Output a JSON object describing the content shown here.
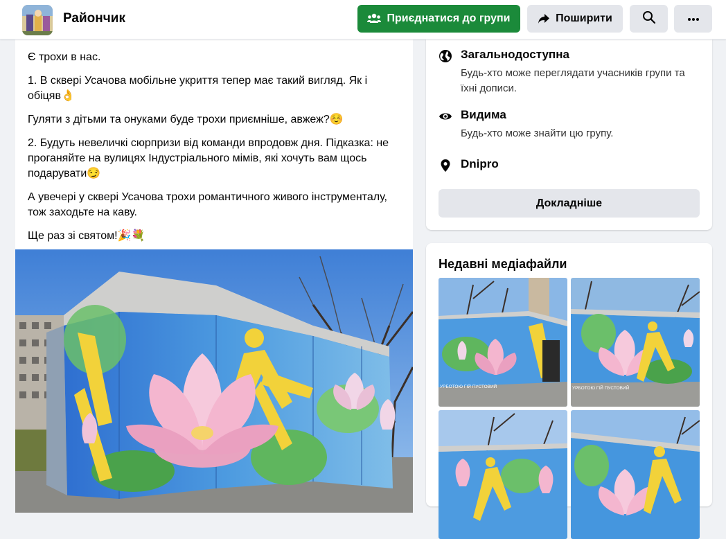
{
  "header": {
    "group_name": "Райончик",
    "join_label": "Приєднатися до групи",
    "share_label": "Поширити",
    "search_icon": "search-icon",
    "more_icon": "more-icon"
  },
  "post": {
    "paragraphs": [
      "Є трохи в нас.",
      "1. В сквері Усачова мобільне укриття тепер має такий вигляд. Як і обіцяв👌",
      "Гуляти з дітьми та онуками буде трохи приємніше, авжеж?☺️",
      "2. Будуть невеличкі сюрпризи від команди впродовж дня. Підказка: не проганяйте на вулицях Індустріального мімів, які хочуть вам щось подарувати😏",
      "А увечері у сквері Усачова трохи романтичного живого інструменталу, тож заходьте на каву.",
      "Ще раз зі святом!🎉💐"
    ]
  },
  "about": {
    "privacy_title": "Загальнодоступна",
    "privacy_desc": "Будь-хто може переглядати учасників групи та їхні дописи.",
    "visibility_title": "Видима",
    "visibility_desc": "Будь-хто може знайти цю групу.",
    "location": "Dnipro",
    "details_label": "Докладніше"
  },
  "media": {
    "title": "Недавні медіафайли",
    "thumb_captions": [
      "УРБОТОЮ ГІЙ ПУСТОВИЙ",
      "УРБОТОЮ ГІЙ ПУСТОВИЙ"
    ]
  },
  "colors": {
    "join_green": "#1b8a3a",
    "secondary_button": "#e4e6eb",
    "page_bg": "#f0f2f5"
  }
}
